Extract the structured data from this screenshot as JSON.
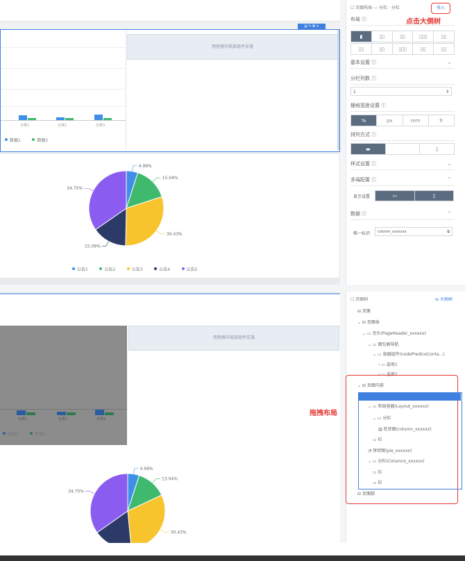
{
  "annotations": {
    "click_enlarge": "点击大倒树",
    "drag_layout": "拖拽布局"
  },
  "placeholder_text": "用拖拽中底部组件实施",
  "pie_top": {
    "labels": [
      "4.99%",
      "15.04%",
      "30.43%",
      "15.09%",
      "34.75%"
    ],
    "legend": [
      "公告1",
      "公告2",
      "公告3",
      "公告4",
      "公告5"
    ]
  },
  "pie_bottom": {
    "labels": [
      "4.99%",
      "13.04%",
      "30.43%",
      "34.75%"
    ]
  },
  "bar_top": {
    "legend": [
      "数据1",
      "数据2"
    ],
    "cats": [
      "分类1",
      "分类2",
      "分类3"
    ]
  },
  "bar_bottom": {
    "legend": [
      "数据1",
      "数据2"
    ],
    "cats": [
      "分类1",
      "分类2",
      "分类3"
    ]
  },
  "right_panel": {
    "header": "页面布局 — 分栏 · 分栏",
    "header_btn": "导入",
    "sec_layout": "布局",
    "sec_basic": "基本设置",
    "sec_columns": "分栏列数",
    "col_input": "1",
    "sec_width": "栅格宽度设置",
    "width_opts": [
      "%",
      "px",
      "rem",
      "fr"
    ],
    "sec_direction": "排列方式",
    "sec_style": "样式设置",
    "sec_device": "多端配置",
    "device_label": "显示设置",
    "sec_data": "数据",
    "data_label": "唯一标识",
    "data_value": "column_xxxxxxx"
  },
  "tree_panel": {
    "header": "页面树",
    "header_btn": "大纲树",
    "rows": [
      "页面",
      "页面体",
      "页头(PageHeader_xxxxxx)",
      "面包屑导航",
      "容器组件(nodePrediceConta...)",
      "选项1",
      "选项2",
      "页面内容",
      "布局容器(Layout_xxxxxx)",
      "分栏",
      "柱状图(column_xxxxxx)",
      "栏",
      "饼状图(pie_xxxxxx)",
      "分栏(Columns_xxxxxx)",
      "栏",
      "栏",
      "页面脚"
    ]
  },
  "chart_data": [
    {
      "type": "pie",
      "categories": [
        "公告1",
        "公告2",
        "公告3",
        "公告4",
        "公告5"
      ],
      "values": [
        4.99,
        15.04,
        30.43,
        15.09,
        34.75
      ],
      "legend": "bottom"
    },
    {
      "type": "pie",
      "categories": [
        "",
        "",
        "",
        "",
        ""
      ],
      "values": [
        4.99,
        13.04,
        30.43,
        16.79,
        34.75
      ]
    }
  ],
  "colors": {
    "blue": "#3f8ee8",
    "green": "#3fb96e",
    "yellow": "#f7c42e",
    "navy": "#2b3a67",
    "purple": "#8a5cf0",
    "accent": "#3f7fe0"
  }
}
